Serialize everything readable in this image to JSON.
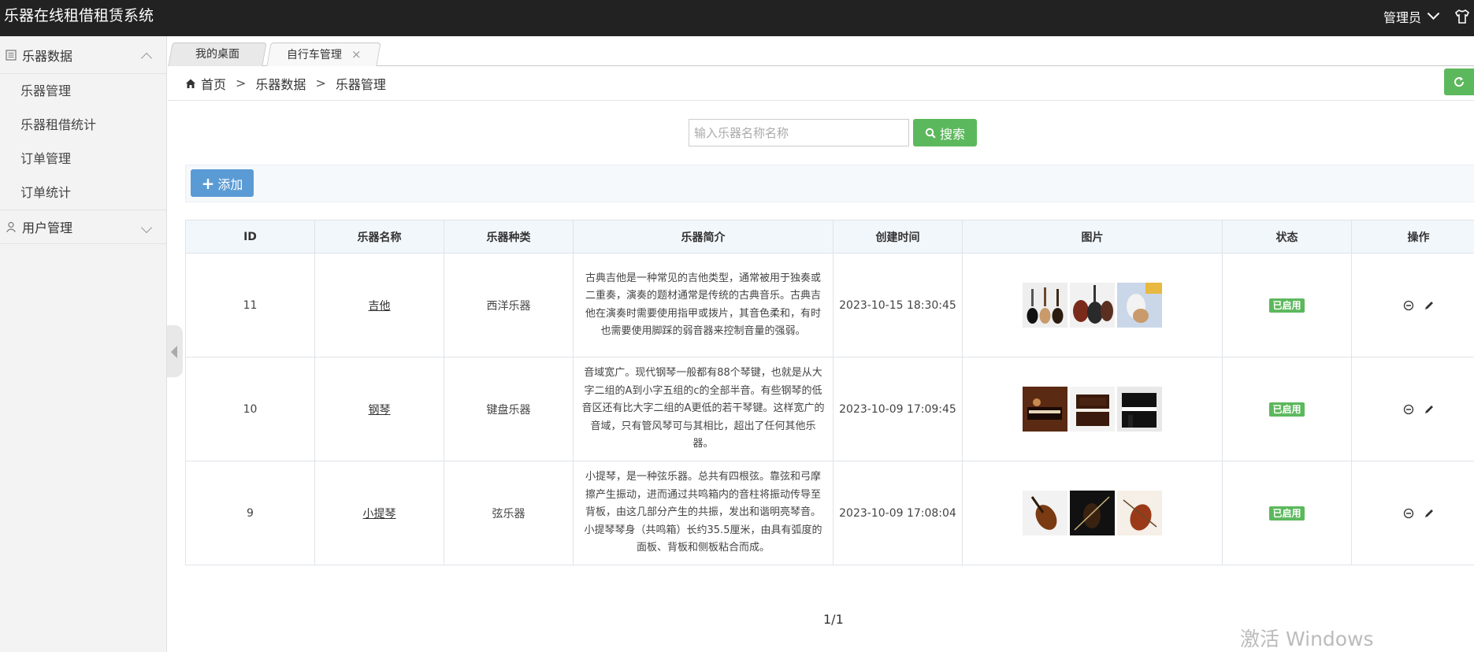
{
  "header": {
    "app_title": "乐器在线租借租赁系统",
    "user_label": "管理员",
    "shirt_icon": "shirt-icon"
  },
  "sidebar": {
    "groups": [
      {
        "label": "乐器数据",
        "icon": "list-icon",
        "expanded": true,
        "items": [
          {
            "label": "乐器管理"
          },
          {
            "label": "乐器租借统计"
          },
          {
            "label": "订单管理"
          },
          {
            "label": "订单统计"
          }
        ]
      },
      {
        "label": "用户管理",
        "icon": "user-icon",
        "expanded": false,
        "items": []
      }
    ]
  },
  "tabs": [
    {
      "label": "我的桌面",
      "active": false
    },
    {
      "label": "自行车管理",
      "active": true,
      "close": "×"
    }
  ],
  "breadcrumb": {
    "home": "首页",
    "sep": ">",
    "level1": "乐器数据",
    "level2": "乐器管理"
  },
  "search": {
    "placeholder": "输入乐器名称名称",
    "value": "",
    "button_label": "搜索"
  },
  "toolbar": {
    "add_label": "添加"
  },
  "table": {
    "columns": [
      "ID",
      "乐器名称",
      "乐器种类",
      "乐器简介",
      "创建时间",
      "图片",
      "状态",
      "操作"
    ],
    "rows": [
      {
        "id": "11",
        "name": "吉他",
        "type": "西洋乐器",
        "desc": "古典吉他是一种常见的吉他类型，通常被用于独奏或二重奏，演奏的题材通常是传统的古典音乐。古典吉他在演奏时需要使用指甲或拨片，其音色柔和，有时也需要使用脚踩的弱音器来控制音量的强弱。",
        "created": "2023-10-15 18:30:45",
        "status": "已启用"
      },
      {
        "id": "10",
        "name": "钢琴",
        "type": "键盘乐器",
        "desc": "音域宽广。现代钢琴一般都有88个琴键，也就是从大字二组的A到小字五组的c的全部半音。有些钢琴的低音区还有比大字二组的A更低的若干琴键。这样宽广的音域，只有管风琴可与其相比，超出了任何其他乐器。",
        "created": "2023-10-09 17:09:45",
        "status": "已启用"
      },
      {
        "id": "9",
        "name": "小提琴",
        "type": "弦乐器",
        "desc": "小提琴，是一种弦乐器。总共有四根弦。靠弦和弓摩擦产生振动，进而通过共鸣箱内的音柱将振动传导至背板，由这几部分产生的共振，发出和谐明亮琴音。小提琴琴身（共鸣箱）长约35.5厘米，由具有弧度的面板、背板和侧板粘合而成。",
        "created": "2023-10-09 17:08:04",
        "status": "已启用"
      }
    ]
  },
  "pagination": {
    "text": "1/1"
  },
  "watermark": {
    "text": "激活 Windows"
  },
  "colors": {
    "topbar": "#222222",
    "green": "#5cb85c",
    "blue": "#5b9bd5"
  }
}
